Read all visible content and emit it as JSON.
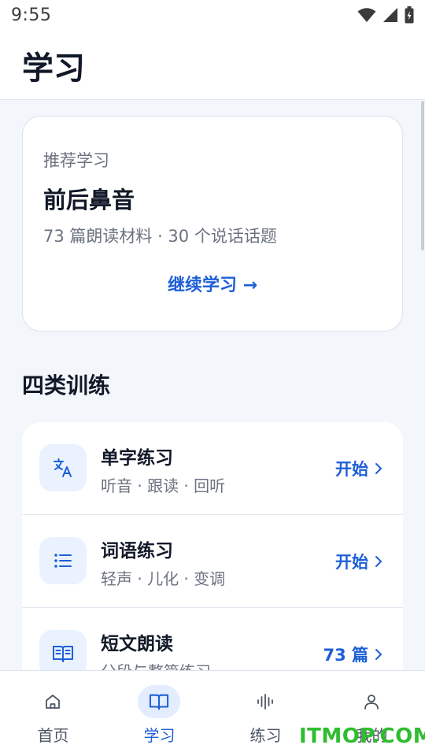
{
  "status_bar": {
    "time": "9:55"
  },
  "header": {
    "title": "学习"
  },
  "recommend": {
    "kicker": "推荐学习",
    "title": "前后鼻音",
    "meta": "73 篇朗读材料 · 30 个说话话题",
    "cta": "继续学习 →"
  },
  "section": {
    "title": "四类训练"
  },
  "items": [
    {
      "icon": "translate-icon",
      "title": "单字练习",
      "subtitle": "听音 · 跟读 · 回听",
      "action": "开始"
    },
    {
      "icon": "list-icon",
      "title": "词语练习",
      "subtitle": "轻声 · 儿化 · 变调",
      "action": "开始"
    },
    {
      "icon": "book-icon",
      "title": "短文朗读",
      "subtitle": "分段与整篇练习",
      "action": "73 篇"
    }
  ],
  "tabs": [
    {
      "icon": "home-icon",
      "label": "首页",
      "active": false
    },
    {
      "icon": "book-icon",
      "label": "学习",
      "active": true
    },
    {
      "icon": "waveform-icon",
      "label": "练习",
      "active": false
    },
    {
      "icon": "user-icon",
      "label": "我的",
      "active": false
    }
  ],
  "watermark": "ITMOP.COM",
  "colors": {
    "accent": "#1d5fd6",
    "icon_bg": "#eaf2ff",
    "background": "#f3f6fb"
  }
}
